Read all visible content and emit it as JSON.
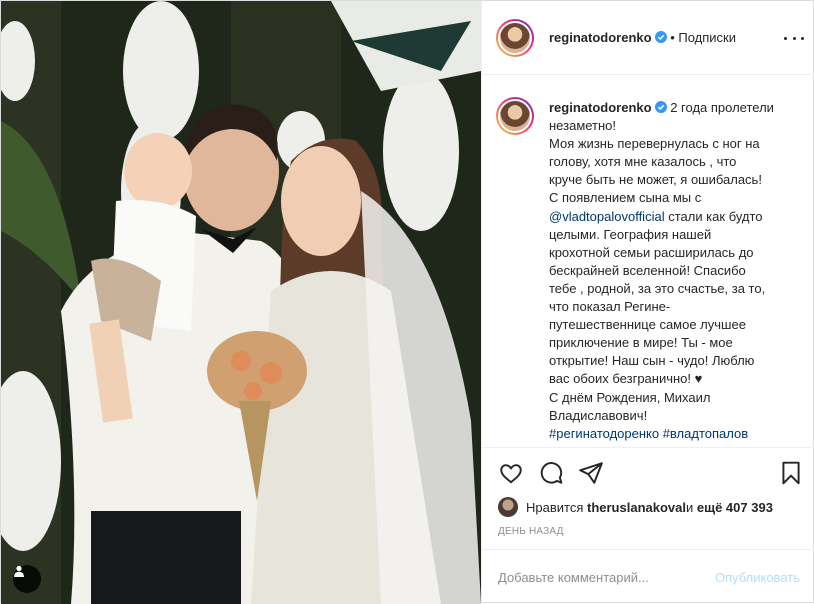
{
  "post": {
    "username": "reginatodorenko",
    "follow_label": "Подписки",
    "caption_lines": [
      {
        "a": "2 года пролетели"
      },
      {
        "a": "незаметно!"
      },
      {
        "a": "Моя жизнь перевернулась с ног на"
      },
      {
        "a": "голову, хотя мне казалось , что"
      },
      {
        "a": "круче быть не может, я ошибалась!"
      },
      {
        "a": "С появлением сына мы с"
      },
      {
        "link": "@vladtopalovofficial",
        "a": " стали как будто"
      },
      {
        "a": "целыми. География нашей"
      },
      {
        "a": "крохотной семьи расширилась до"
      },
      {
        "a": "бескрайней вселенной! Спасибо"
      },
      {
        "a": "тебе , родной, за это счастье, за то,"
      },
      {
        "a": "что показал Регине-"
      },
      {
        "a": "путешественнице самое лучшее"
      },
      {
        "a": "приключение в мире! Ты - мое"
      },
      {
        "a": "открытие! Наш сын - чудо! Люблю"
      },
      {
        "a": "вас обоих безгранично! ♥"
      },
      {
        "a": "С днём Рождения, Михаил"
      },
      {
        "a": "Владиславович!"
      },
      {
        "link": "#регинатодоренко #владтопалов"
      }
    ],
    "likes_prefix": "Нравится ",
    "likes_user": "theruslanakoval",
    "likes_middle": " и ",
    "likes_count": "ещё 407 393",
    "timestamp": "ДЕНЬ НАЗАД",
    "comment_placeholder": "Добавьте комментарий...",
    "publish_label": "Опубликовать"
  },
  "icons": {
    "like": "heart-icon",
    "comment": "comment-icon",
    "share": "share-icon",
    "save": "bookmark-icon",
    "more": "more-options-icon",
    "verified": "verified-badge-icon",
    "tag": "user-tag-icon"
  },
  "colors": {
    "link": "#00376b",
    "verified": "#3897f0",
    "muted": "#8e8e8e",
    "publish_disabled": "#b2dffc"
  }
}
